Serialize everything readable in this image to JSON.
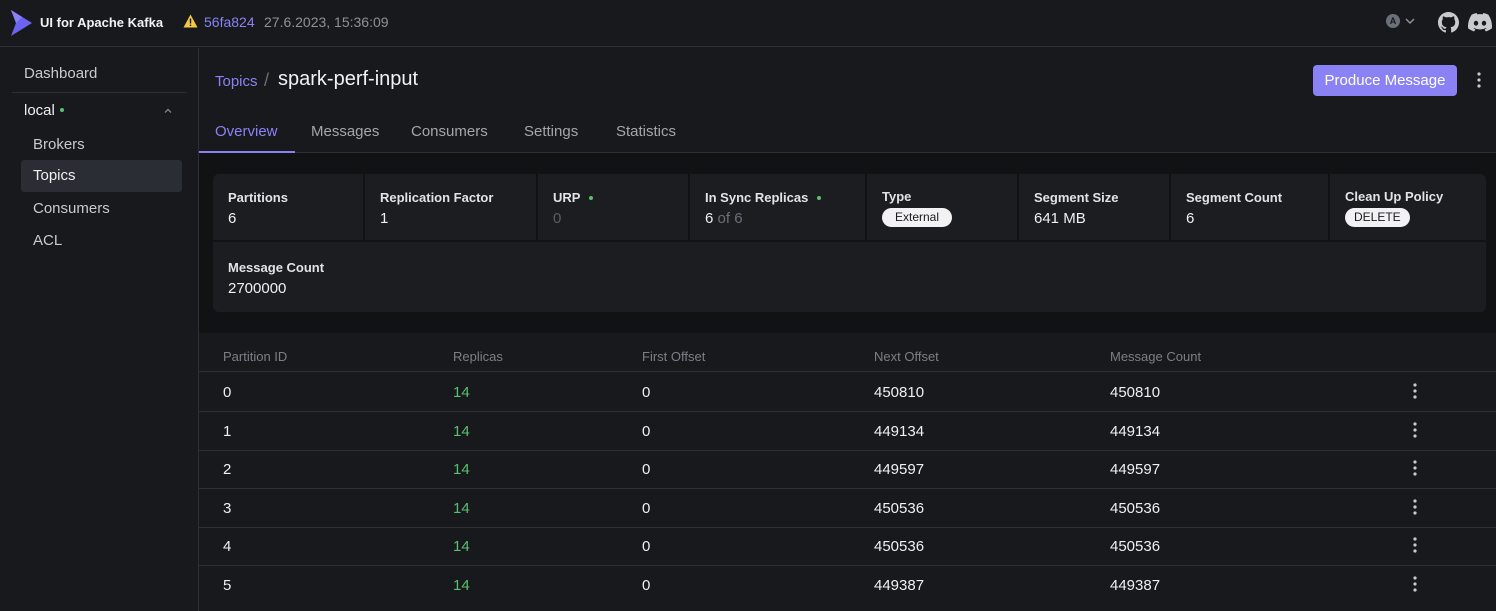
{
  "app": {
    "title": "UI for Apache Kafka"
  },
  "version": {
    "commit": "56fa824",
    "date": "27.6.2023, 15:36:09"
  },
  "user": {
    "initial": "A"
  },
  "sidebar": {
    "dashboard": "Dashboard",
    "cluster": {
      "name": "local",
      "status_color": "#5ac06c"
    },
    "items": [
      {
        "label": "Brokers",
        "active": false
      },
      {
        "label": "Topics",
        "active": true
      },
      {
        "label": "Consumers",
        "active": false
      },
      {
        "label": "ACL",
        "active": false
      }
    ]
  },
  "header": {
    "breadcrumb": "Topics",
    "separator": "/",
    "title": "spark-perf-input",
    "produce_label": "Produce Message"
  },
  "tabs": [
    {
      "label": "Overview",
      "active": true
    },
    {
      "label": "Messages",
      "active": false
    },
    {
      "label": "Consumers",
      "active": false
    },
    {
      "label": "Settings",
      "active": false
    },
    {
      "label": "Statistics",
      "active": false
    }
  ],
  "stats": {
    "partitions": {
      "label": "Partitions",
      "value": "6"
    },
    "replication": {
      "label": "Replication Factor",
      "value": "1"
    },
    "urp": {
      "label": "URP",
      "value": "0"
    },
    "in_sync": {
      "label": "In Sync Replicas",
      "value": "6",
      "of": "of 6"
    },
    "type": {
      "label": "Type",
      "value": "External"
    },
    "segment_size": {
      "label": "Segment Size",
      "value": "641 MB"
    },
    "segment_count": {
      "label": "Segment Count",
      "value": "6"
    },
    "cleanup": {
      "label": "Clean Up Policy",
      "value": "DELETE"
    },
    "message_count": {
      "label": "Message Count",
      "value": "2700000"
    }
  },
  "table": {
    "headers": [
      "Partition ID",
      "Replicas",
      "First Offset",
      "Next Offset",
      "Message Count"
    ],
    "rows": [
      {
        "partition": "0",
        "replicas": "14",
        "first": "0",
        "next": "450810",
        "count": "450810"
      },
      {
        "partition": "1",
        "replicas": "14",
        "first": "0",
        "next": "449134",
        "count": "449134"
      },
      {
        "partition": "2",
        "replicas": "14",
        "first": "0",
        "next": "449597",
        "count": "449597"
      },
      {
        "partition": "3",
        "replicas": "14",
        "first": "0",
        "next": "450536",
        "count": "450536"
      },
      {
        "partition": "4",
        "replicas": "14",
        "first": "0",
        "next": "450536",
        "count": "450536"
      },
      {
        "partition": "5",
        "replicas": "14",
        "first": "0",
        "next": "449387",
        "count": "449387"
      }
    ]
  },
  "colors": {
    "accent": "#8a82f4",
    "ok": "#5ac06c",
    "warning": "#f5c842"
  },
  "icons": [
    "kafka-logo-icon",
    "warning-icon",
    "avatar-icon",
    "chevron-down-icon",
    "github-icon",
    "discord-icon",
    "chevron-up-icon",
    "kebab-menu-icon"
  ]
}
